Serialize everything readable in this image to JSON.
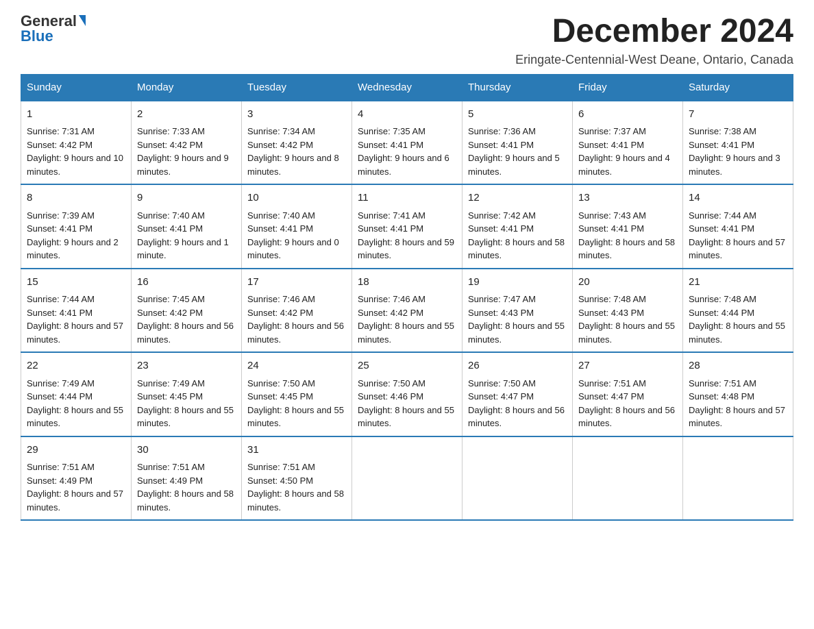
{
  "header": {
    "logo_general": "General",
    "logo_blue": "Blue",
    "month_title": "December 2024",
    "location": "Eringate-Centennial-West Deane, Ontario, Canada"
  },
  "days_of_week": [
    "Sunday",
    "Monday",
    "Tuesday",
    "Wednesday",
    "Thursday",
    "Friday",
    "Saturday"
  ],
  "weeks": [
    [
      {
        "day": "1",
        "sunrise": "7:31 AM",
        "sunset": "4:42 PM",
        "daylight": "9 hours and 10 minutes."
      },
      {
        "day": "2",
        "sunrise": "7:33 AM",
        "sunset": "4:42 PM",
        "daylight": "9 hours and 9 minutes."
      },
      {
        "day": "3",
        "sunrise": "7:34 AM",
        "sunset": "4:42 PM",
        "daylight": "9 hours and 8 minutes."
      },
      {
        "day": "4",
        "sunrise": "7:35 AM",
        "sunset": "4:41 PM",
        "daylight": "9 hours and 6 minutes."
      },
      {
        "day": "5",
        "sunrise": "7:36 AM",
        "sunset": "4:41 PM",
        "daylight": "9 hours and 5 minutes."
      },
      {
        "day": "6",
        "sunrise": "7:37 AM",
        "sunset": "4:41 PM",
        "daylight": "9 hours and 4 minutes."
      },
      {
        "day": "7",
        "sunrise": "7:38 AM",
        "sunset": "4:41 PM",
        "daylight": "9 hours and 3 minutes."
      }
    ],
    [
      {
        "day": "8",
        "sunrise": "7:39 AM",
        "sunset": "4:41 PM",
        "daylight": "9 hours and 2 minutes."
      },
      {
        "day": "9",
        "sunrise": "7:40 AM",
        "sunset": "4:41 PM",
        "daylight": "9 hours and 1 minute."
      },
      {
        "day": "10",
        "sunrise": "7:40 AM",
        "sunset": "4:41 PM",
        "daylight": "9 hours and 0 minutes."
      },
      {
        "day": "11",
        "sunrise": "7:41 AM",
        "sunset": "4:41 PM",
        "daylight": "8 hours and 59 minutes."
      },
      {
        "day": "12",
        "sunrise": "7:42 AM",
        "sunset": "4:41 PM",
        "daylight": "8 hours and 58 minutes."
      },
      {
        "day": "13",
        "sunrise": "7:43 AM",
        "sunset": "4:41 PM",
        "daylight": "8 hours and 58 minutes."
      },
      {
        "day": "14",
        "sunrise": "7:44 AM",
        "sunset": "4:41 PM",
        "daylight": "8 hours and 57 minutes."
      }
    ],
    [
      {
        "day": "15",
        "sunrise": "7:44 AM",
        "sunset": "4:41 PM",
        "daylight": "8 hours and 57 minutes."
      },
      {
        "day": "16",
        "sunrise": "7:45 AM",
        "sunset": "4:42 PM",
        "daylight": "8 hours and 56 minutes."
      },
      {
        "day": "17",
        "sunrise": "7:46 AM",
        "sunset": "4:42 PM",
        "daylight": "8 hours and 56 minutes."
      },
      {
        "day": "18",
        "sunrise": "7:46 AM",
        "sunset": "4:42 PM",
        "daylight": "8 hours and 55 minutes."
      },
      {
        "day": "19",
        "sunrise": "7:47 AM",
        "sunset": "4:43 PM",
        "daylight": "8 hours and 55 minutes."
      },
      {
        "day": "20",
        "sunrise": "7:48 AM",
        "sunset": "4:43 PM",
        "daylight": "8 hours and 55 minutes."
      },
      {
        "day": "21",
        "sunrise": "7:48 AM",
        "sunset": "4:44 PM",
        "daylight": "8 hours and 55 minutes."
      }
    ],
    [
      {
        "day": "22",
        "sunrise": "7:49 AM",
        "sunset": "4:44 PM",
        "daylight": "8 hours and 55 minutes."
      },
      {
        "day": "23",
        "sunrise": "7:49 AM",
        "sunset": "4:45 PM",
        "daylight": "8 hours and 55 minutes."
      },
      {
        "day": "24",
        "sunrise": "7:50 AM",
        "sunset": "4:45 PM",
        "daylight": "8 hours and 55 minutes."
      },
      {
        "day": "25",
        "sunrise": "7:50 AM",
        "sunset": "4:46 PM",
        "daylight": "8 hours and 55 minutes."
      },
      {
        "day": "26",
        "sunrise": "7:50 AM",
        "sunset": "4:47 PM",
        "daylight": "8 hours and 56 minutes."
      },
      {
        "day": "27",
        "sunrise": "7:51 AM",
        "sunset": "4:47 PM",
        "daylight": "8 hours and 56 minutes."
      },
      {
        "day": "28",
        "sunrise": "7:51 AM",
        "sunset": "4:48 PM",
        "daylight": "8 hours and 57 minutes."
      }
    ],
    [
      {
        "day": "29",
        "sunrise": "7:51 AM",
        "sunset": "4:49 PM",
        "daylight": "8 hours and 57 minutes."
      },
      {
        "day": "30",
        "sunrise": "7:51 AM",
        "sunset": "4:49 PM",
        "daylight": "8 hours and 58 minutes."
      },
      {
        "day": "31",
        "sunrise": "7:51 AM",
        "sunset": "4:50 PM",
        "daylight": "8 hours and 58 minutes."
      },
      null,
      null,
      null,
      null
    ]
  ]
}
